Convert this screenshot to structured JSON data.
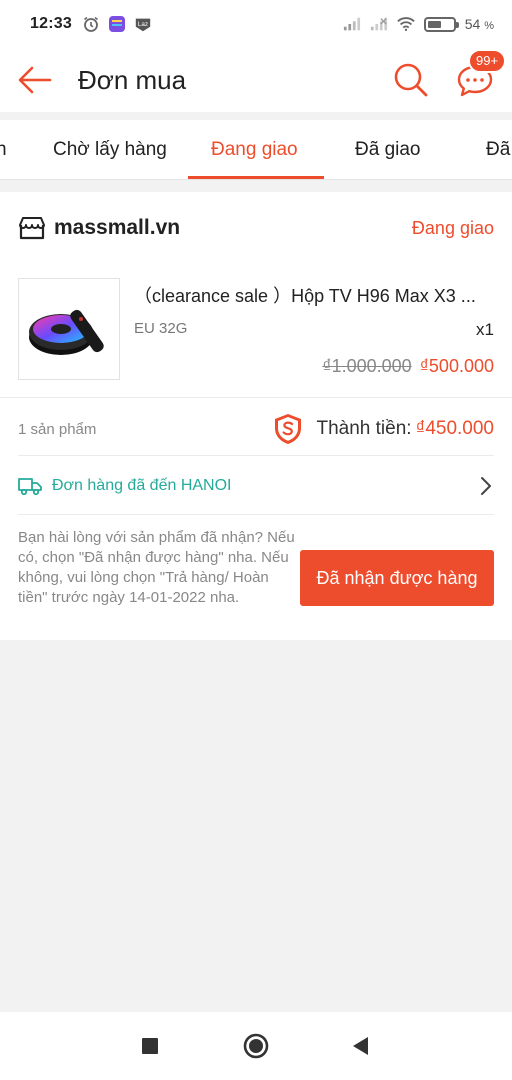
{
  "status_bar": {
    "time": "12:33",
    "battery_percent": "54",
    "battery_suffix": "%",
    "battery_level": 0.54,
    "left_icons": [
      "alarm-icon",
      "app-notification-icon",
      "lazada-icon"
    ],
    "right_icons": [
      "signal-icon",
      "signal-weak-icon",
      "wifi-icon",
      "battery-icon"
    ]
  },
  "header": {
    "title": "Đơn mua",
    "cart_badge": "99+",
    "accent_color": "#ee4d2d"
  },
  "tabs": [
    {
      "label": "n"
    },
    {
      "label": "Chờ lấy hàng"
    },
    {
      "label": "Đang giao",
      "active": true
    },
    {
      "label": "Đã giao"
    },
    {
      "label": "Đã"
    }
  ],
  "order": {
    "shop_name": "massmall.vn",
    "status": "Đang giao",
    "product": {
      "name": "（clearance sale ）Hộp TV H96 Max X3 ...",
      "variant": "EU 32G",
      "quantity": "x1",
      "price_original": "₫1.000.000",
      "price_current": "₫500.000"
    },
    "item_count": "1 sản phẩm",
    "total_label": "Thành tiền:",
    "total_value": "₫450.000",
    "shipping_status": "Đơn hàng đã đến HANOI",
    "confirm_message": "Bạn hài lòng với sản phẩm đã nhận? Nếu có, chọn \"Đã nhận được hàng\" nha. Nếu không, vui lòng chọn \"Trả hàng/ Hoàn tiền\" trước ngày 14-01-2022 nha.",
    "confirm_button": "Đã nhận được hàng"
  },
  "colors": {
    "accent": "#ee4d2d",
    "shipping_teal": "#26aa99"
  }
}
